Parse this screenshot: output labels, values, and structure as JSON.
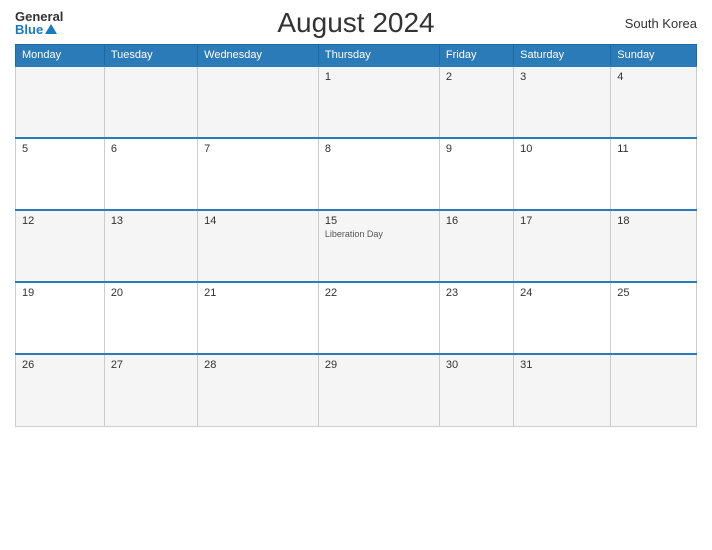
{
  "header": {
    "logo_general": "General",
    "logo_blue": "Blue",
    "title": "August 2024",
    "country": "South Korea"
  },
  "weekdays": [
    "Monday",
    "Tuesday",
    "Wednesday",
    "Thursday",
    "Friday",
    "Saturday",
    "Sunday"
  ],
  "weeks": [
    [
      {
        "day": "",
        "event": ""
      },
      {
        "day": "",
        "event": ""
      },
      {
        "day": "",
        "event": ""
      },
      {
        "day": "1",
        "event": ""
      },
      {
        "day": "2",
        "event": ""
      },
      {
        "day": "3",
        "event": ""
      },
      {
        "day": "4",
        "event": ""
      }
    ],
    [
      {
        "day": "5",
        "event": ""
      },
      {
        "day": "6",
        "event": ""
      },
      {
        "day": "7",
        "event": ""
      },
      {
        "day": "8",
        "event": ""
      },
      {
        "day": "9",
        "event": ""
      },
      {
        "day": "10",
        "event": ""
      },
      {
        "day": "11",
        "event": ""
      }
    ],
    [
      {
        "day": "12",
        "event": ""
      },
      {
        "day": "13",
        "event": ""
      },
      {
        "day": "14",
        "event": ""
      },
      {
        "day": "15",
        "event": "Liberation Day"
      },
      {
        "day": "16",
        "event": ""
      },
      {
        "day": "17",
        "event": ""
      },
      {
        "day": "18",
        "event": ""
      }
    ],
    [
      {
        "day": "19",
        "event": ""
      },
      {
        "day": "20",
        "event": ""
      },
      {
        "day": "21",
        "event": ""
      },
      {
        "day": "22",
        "event": ""
      },
      {
        "day": "23",
        "event": ""
      },
      {
        "day": "24",
        "event": ""
      },
      {
        "day": "25",
        "event": ""
      }
    ],
    [
      {
        "day": "26",
        "event": ""
      },
      {
        "day": "27",
        "event": ""
      },
      {
        "day": "28",
        "event": ""
      },
      {
        "day": "29",
        "event": ""
      },
      {
        "day": "30",
        "event": ""
      },
      {
        "day": "31",
        "event": ""
      },
      {
        "day": "",
        "event": ""
      }
    ]
  ]
}
